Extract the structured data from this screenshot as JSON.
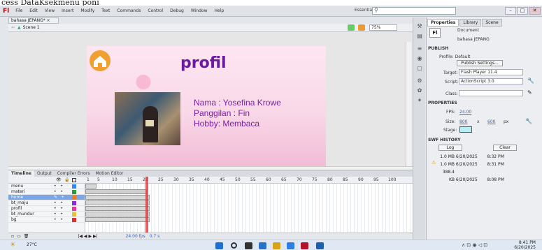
{
  "caption": "cess DataKsekmenu poni",
  "app": {
    "logo": "Fl"
  },
  "menus": [
    "File",
    "Edit",
    "View",
    "Insert",
    "Modify",
    "Text",
    "Commands",
    "Control",
    "Debug",
    "Window",
    "Help"
  ],
  "workspace": "Essentials",
  "search_placeholder": "",
  "document_tab": "bahasa JEPANG* ×",
  "scene": "Scene 1",
  "zoom": "75%",
  "stage": {
    "title": "profil",
    "lines": [
      "Nama : Yosefina Krowe",
      "Panggilan : Fin",
      "Hobby:  Membaca"
    ]
  },
  "timeline": {
    "tabs": [
      "Timeline",
      "Output",
      "Compiler Errors",
      "Motion Editor"
    ],
    "ruler": [
      "1",
      "5",
      "10",
      "15",
      "20",
      "25",
      "30",
      "35",
      "40",
      "45",
      "50",
      "55",
      "60",
      "65",
      "70",
      "75",
      "80",
      "85",
      "90",
      "95",
      "100"
    ],
    "layers": [
      {
        "name": "menu",
        "color": "#2d8cf0"
      },
      {
        "name": "materi",
        "color": "#2a9d3a"
      },
      {
        "name": "home",
        "color": "#f07c1a"
      },
      {
        "name": "bt_maju",
        "color": "#8a2be2"
      },
      {
        "name": "profil",
        "color": "#e03a9a"
      },
      {
        "name": "bt_mundur",
        "color": "#e0c23a"
      },
      {
        "name": "bg",
        "color": "#d93030"
      }
    ],
    "footer": {
      "fps": "24.00 fps",
      "time": "0.7 s"
    }
  },
  "panel": {
    "tabs": [
      "Properties",
      "Library",
      "Scene"
    ],
    "doc_label": "Document",
    "doc_name": "bahasa JEPANG",
    "publish_header": "PUBLISH",
    "profile": "Profile: Default",
    "publish_settings": "Publish Settings...",
    "target_label": "Target:",
    "target": "Flash Player 11.4",
    "script_label": "Script:",
    "script": "ActionScript 3.0",
    "class_label": "Class:",
    "properties_header": "PROPERTIES",
    "fps_label": "FPS:",
    "fps": "24.00",
    "size_label": "Size:",
    "width": "800",
    "x": "x",
    "height": "600",
    "px": "px",
    "stage_label": "Stage:",
    "stage_color": "#b8eef5",
    "history_header": "SWF HISTORY",
    "log": "Log",
    "clear": "Clear",
    "history": [
      {
        "size": "1.0 MB",
        "date": "6/20/2025",
        "time": "8:32 PM"
      },
      {
        "size": "1.0 MB",
        "date": "6/20/2025",
        "time": "8:31 PM"
      },
      {
        "size": "388.4 KB",
        "date": "6/20/2025",
        "time": "8:08 PM"
      }
    ]
  },
  "taskbar": {
    "temp": "27°C",
    "clock_time": "8:41 PM",
    "clock_date": "6/20/2025"
  }
}
